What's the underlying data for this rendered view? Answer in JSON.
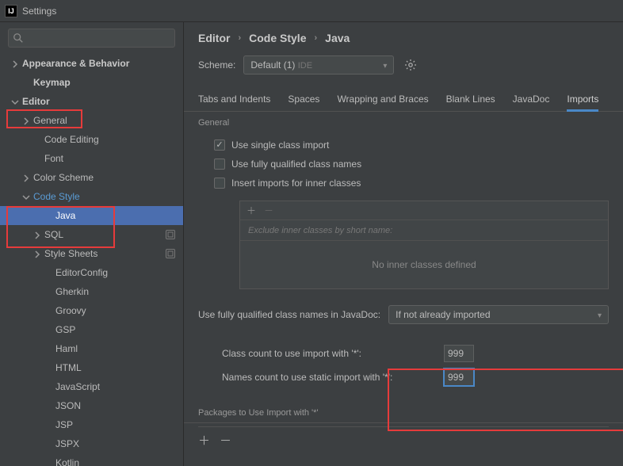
{
  "window_title": "Settings",
  "search_placeholder": "",
  "sidebar": {
    "items": [
      {
        "label": "Appearance & Behavior",
        "bold": true,
        "chev": "right",
        "pad": 0
      },
      {
        "label": "Keymap",
        "bold": true,
        "pad": 1
      },
      {
        "label": "Editor",
        "bold": true,
        "chev": "down",
        "pad": 0,
        "accent": false
      },
      {
        "label": "General",
        "chev": "right",
        "pad": 1
      },
      {
        "label": "Code Editing",
        "pad": 2
      },
      {
        "label": "Font",
        "pad": 2
      },
      {
        "label": "Color Scheme",
        "chev": "right",
        "pad": 1
      },
      {
        "label": "Code Style",
        "chev": "down",
        "pad": 1,
        "accent": true
      },
      {
        "label": "Java",
        "pad": 3,
        "selected": true
      },
      {
        "label": "SQL",
        "chev": "right",
        "pad": 2,
        "badge": true
      },
      {
        "label": "Style Sheets",
        "chev": "right",
        "pad": 2,
        "badge": true
      },
      {
        "label": "EditorConfig",
        "pad": 3
      },
      {
        "label": "Gherkin",
        "pad": 3
      },
      {
        "label": "Groovy",
        "pad": 3
      },
      {
        "label": "GSP",
        "pad": 3
      },
      {
        "label": "Haml",
        "pad": 3
      },
      {
        "label": "HTML",
        "pad": 3
      },
      {
        "label": "JavaScript",
        "pad": 3
      },
      {
        "label": "JSON",
        "pad": 3
      },
      {
        "label": "JSP",
        "pad": 3
      },
      {
        "label": "JSPX",
        "pad": 3
      },
      {
        "label": "Kotlin",
        "pad": 3
      }
    ]
  },
  "breadcrumb": [
    "Editor",
    "Code Style",
    "Java"
  ],
  "scheme_label": "Scheme:",
  "scheme_value": "Default (1)",
  "scheme_tag": "IDE",
  "tabs": [
    "Tabs and Indents",
    "Spaces",
    "Wrapping and Braces",
    "Blank Lines",
    "JavaDoc",
    "Imports"
  ],
  "active_tab": "Imports",
  "section_general": "General",
  "checks": [
    {
      "label": "Use single class import",
      "checked": true
    },
    {
      "label": "Use fully qualified class names",
      "checked": false
    },
    {
      "label": "Insert imports for inner classes",
      "checked": false
    }
  ],
  "exclude_placeholder": "Exclude inner classes by short name:",
  "exclude_empty": "No inner classes defined",
  "javadoc_label": "Use fully qualified class names in JavaDoc:",
  "javadoc_value": "If not already imported",
  "class_count_label": "Class count to use import with '*':",
  "class_count_value": "999",
  "names_count_label": "Names count to use static import with '*':",
  "names_count_value": "999",
  "packages_label": "Packages to Use Import with '*'"
}
